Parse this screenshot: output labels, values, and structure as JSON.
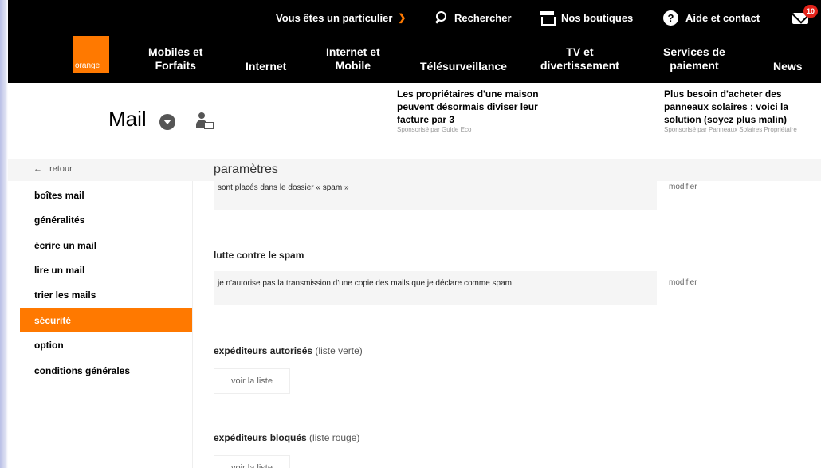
{
  "topbar": {
    "particulier": "Vous êtes un particulier",
    "search": "Rechercher",
    "shops": "Nos boutiques",
    "help": "Aide et contact",
    "mail_badge": "10"
  },
  "brand": {
    "logo_text": "orange",
    "accent": "#ff7900"
  },
  "nav": {
    "mobiles": [
      "Mobiles et",
      "Forfaits"
    ],
    "internet": "Internet",
    "internet_mobile": [
      "Internet et",
      "Mobile"
    ],
    "telesurveillance": "Télésurveillance",
    "tv": [
      "TV et",
      "divertissement"
    ],
    "services": [
      "Services de",
      "paiement"
    ],
    "news": "News"
  },
  "mail": {
    "title": "Mail"
  },
  "ads": [
    {
      "title": "Les propriétaires d'une maison peuvent désormais diviser leur facture par 3",
      "sponsor": "Sponsorisé par Guide Eco"
    },
    {
      "title": "Plus besoin d'acheter des panneaux solaires : voici la solution (soyez plus malin)",
      "sponsor": "Sponsorisé par Panneaux Solaires Propriétaire"
    }
  ],
  "breadcrumb": {
    "retour": "retour",
    "params": "paramètres"
  },
  "sidebar": {
    "items": [
      {
        "label": "boîtes mail"
      },
      {
        "label": "généralités"
      },
      {
        "label": "écrire un mail"
      },
      {
        "label": "lire un mail"
      },
      {
        "label": "trier les mails"
      },
      {
        "label": "sécurité"
      },
      {
        "label": "option"
      },
      {
        "label": "conditions générales"
      }
    ]
  },
  "content": {
    "row1_text": "sont placés dans le dossier « spam »",
    "modify": "modifier",
    "spam_title": "lutte contre le spam",
    "spam_text": "je n'autorise pas la transmission d'une copie des mails que je déclare comme spam",
    "allowed_title": "expéditeurs autorisés",
    "allowed_sub": "(liste verte)",
    "allowed_button": "voir la liste",
    "blocked_title": "expéditeurs bloqués",
    "blocked_sub": "(liste rouge)",
    "blocked_button": "voir la liste"
  }
}
